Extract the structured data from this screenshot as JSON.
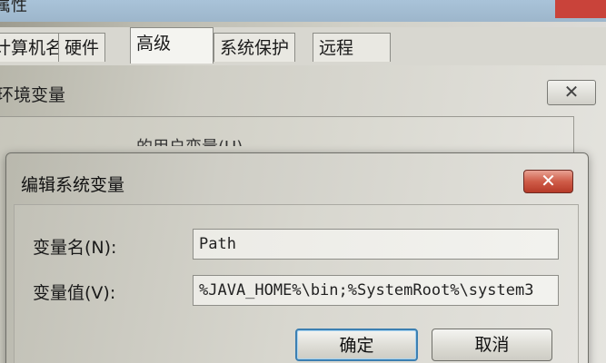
{
  "system_properties": {
    "title": "属性",
    "tabs": [
      {
        "label": "计算机名"
      },
      {
        "label": "硬件"
      },
      {
        "label": "高级",
        "active": true
      },
      {
        "label": "系统保护"
      },
      {
        "label": "远程"
      }
    ]
  },
  "env_dialog": {
    "title": "环境变量",
    "close_glyph": "✕",
    "user_vars_label": "的用户变量(U)"
  },
  "edit_dialog": {
    "title": "编辑系统变量",
    "close_glyph": "✕",
    "name_label": "变量名(N):",
    "name_value": "Path",
    "value_label": "变量值(V):",
    "value_value": "%JAVA_HOME%\\bin;%SystemRoot%\\system3",
    "ok_label": "确定",
    "cancel_label": "取消"
  },
  "colors": {
    "titlebar": "#a9c3d9",
    "close_red": "#cf5c48",
    "focus_blue": "#3c7fb1"
  }
}
